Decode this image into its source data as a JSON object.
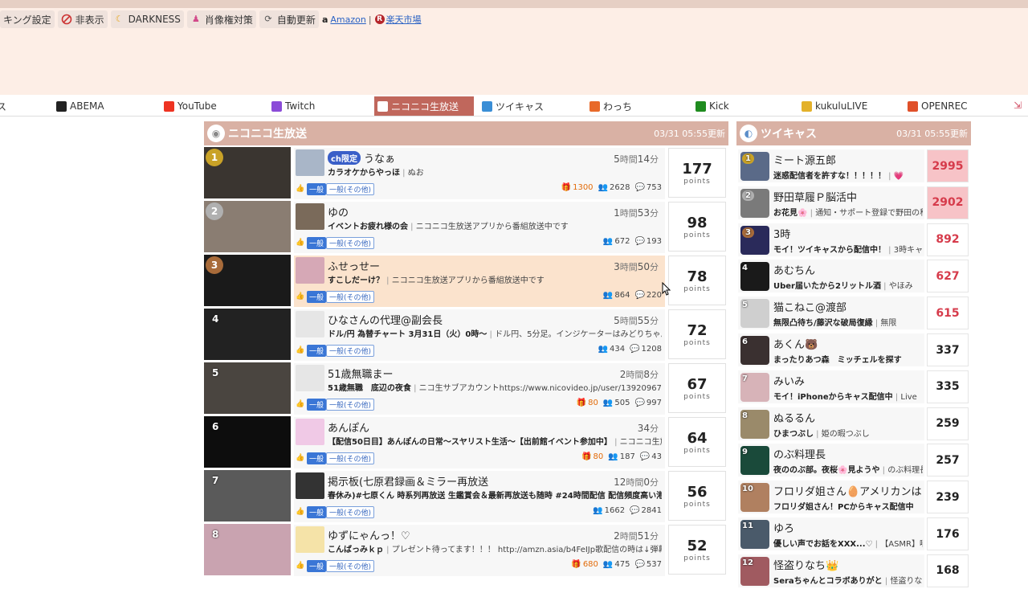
{
  "toolbar": {
    "items": [
      {
        "label": "キング設定",
        "icon": "list-icon"
      },
      {
        "label": "非表示",
        "icon": "prohibit-icon"
      },
      {
        "label": "DARKNESS",
        "icon": "moon-icon"
      },
      {
        "label": "肖像権対策",
        "icon": "person-icon"
      },
      {
        "label": "自動更新",
        "icon": "refresh-icon"
      }
    ],
    "amazon": "Amazon",
    "rakuten": "楽天市場",
    "sep": "|"
  },
  "tabs": [
    {
      "label": "ス",
      "icon": "",
      "color": "#888"
    },
    {
      "label": "ABEMA",
      "icon": "abema-icon",
      "color": "#222"
    },
    {
      "label": "YouTube",
      "icon": "youtube-icon",
      "color": "#e32"
    },
    {
      "label": "Twitch",
      "icon": "twitch-icon",
      "color": "#8b4bd8"
    },
    {
      "label": "ニコニコ生放送",
      "icon": "niconico-icon",
      "color": "#fff",
      "active": true
    },
    {
      "label": "ツイキャス",
      "icon": "twitcasting-icon",
      "color": "#3a8ed6"
    },
    {
      "label": "わっち",
      "icon": "wacchi-icon",
      "color": "#e86a2a"
    },
    {
      "label": "Kick",
      "icon": "kick-icon",
      "color": "#1f8c1f"
    },
    {
      "label": "kukuluLIVE",
      "icon": "kukulu-icon",
      "color": "#e3b12a"
    },
    {
      "label": "OPENREC",
      "icon": "openrec-icon",
      "color": "#e0502a"
    }
  ],
  "nico": {
    "title": "ニコニコ生放送",
    "updated": "03/31 05:55更新",
    "rows": [
      {
        "rank": "1",
        "ch": "ch限定",
        "name": "うなぁ",
        "hours": "5",
        "mins": "14",
        "desc": "カラオケからやっほ",
        "sub": "ぬお",
        "gift": "1300",
        "viewers": "2628",
        "comments": "753",
        "points": "177",
        "hl": false
      },
      {
        "rank": "2",
        "ch": "",
        "name": "ゆの",
        "hours": "1",
        "mins": "53",
        "desc": "イベントお疲れ様の会",
        "sub": "ニコニコ生放送アプリから番組放送中です",
        "gift": "",
        "viewers": "672",
        "comments": "193",
        "points": "98",
        "hl": false
      },
      {
        "rank": "3",
        "ch": "",
        "name": "ふせっせー",
        "hours": "3",
        "mins": "50",
        "desc": "すこしだーけ？",
        "sub": "ニコニコ生放送アプリから番組放送中です",
        "gift": "",
        "viewers": "864",
        "comments": "220",
        "points": "78",
        "hl": true
      },
      {
        "rank": "4",
        "ch": "",
        "name": "ひなさんの代理@副会長",
        "hours": "5",
        "mins": "55",
        "desc": "ドル/円 為替チャート 3月31日（火）0時〜",
        "sub": "ドル円、5分足。インジケーターはみどりちゃん",
        "gift": "",
        "viewers": "434",
        "comments": "1208",
        "points": "72",
        "hl": false
      },
      {
        "rank": "5",
        "ch": "",
        "name": "51歳無職まー",
        "hours": "2",
        "mins": "8",
        "desc": "51歳無職　底辺の夜食",
        "sub": "ニコ生サブアカウントhttps://www.nicovideo.jp/user/139209674ふ",
        "gift": "80",
        "viewers": "505",
        "comments": "997",
        "points": "67",
        "hl": false
      },
      {
        "rank": "6",
        "ch": "",
        "name": "あんぽん",
        "hours": "",
        "mins": "34",
        "desc": "【配信50日目】あんぽんの日常〜スヤリスト生活〜【出前館イベント参加中】",
        "sub": "ニコニコ生放",
        "gift": "80",
        "viewers": "187",
        "comments": "43",
        "points": "64",
        "hl": false
      },
      {
        "rank": "7",
        "ch": "",
        "name": "掲示板(七原君録画＆ミラー再放送",
        "hours": "12",
        "mins": "0",
        "desc": "春休み)#七原くん 時系列再放送 生鑑賞会＆最新再放送も随時 #24時間配信 配信頻度高い港平",
        "sub": "",
        "gift": "",
        "viewers": "1662",
        "comments": "2841",
        "points": "56",
        "hl": false
      },
      {
        "rank": "8",
        "ch": "",
        "name": "ゆずにゃんっ！♡",
        "hours": "2",
        "mins": "51",
        "desc": "こんばっみｋｐ",
        "sub": "プレゼント待ってます！！！ http://amzn.asia/b4FeIJp歌配信の時は↓弾幕",
        "gift": "680",
        "viewers": "475",
        "comments": "537",
        "points": "52",
        "hl": false
      }
    ],
    "genre_main": "一般",
    "genre_sub": "一般(その他)",
    "hour_unit": "時間",
    "min_unit": "分",
    "points_label": "points"
  },
  "twi": {
    "title": "ツイキャス",
    "updated": "03/31 05:55更新",
    "rows": [
      {
        "rank": "1",
        "name": "ミート源五郎",
        "desc": "迷惑配信者を許すな！！！！！",
        "sub": "💗",
        "points": "2995",
        "style": "pink"
      },
      {
        "rank": "2",
        "name": "野田草履Ｐ脳活中",
        "desc": "お花見🌸",
        "sub": "通知・サポート登録で野田の私",
        "points": "2902",
        "style": "pink"
      },
      {
        "rank": "3",
        "name": "3時",
        "desc": "モイ！ツイキャスから配信中！",
        "sub": "3時キャス",
        "points": "892",
        "style": "red"
      },
      {
        "rank": "4",
        "name": "あむちん",
        "desc": "Uber届いたから2リットル酒",
        "sub": "やほみ",
        "points": "627",
        "style": "red"
      },
      {
        "rank": "5",
        "name": "猫こねこ@渡部",
        "desc": "無限凸待ち/藤沢な破局復縁",
        "sub": "無限",
        "points": "615",
        "style": "red"
      },
      {
        "rank": "6",
        "name": "あくん🐻",
        "desc": "まったりあつ森　ミッチェルを探す",
        "sub": "",
        "points": "337",
        "style": ""
      },
      {
        "rank": "7",
        "name": "みいみ",
        "desc": "モイ！iPhoneからキャス配信中",
        "sub": "Live",
        "points": "335",
        "style": ""
      },
      {
        "rank": "8",
        "name": "ぬるるん",
        "desc": "ひまつぶし",
        "sub": "姫の暇つぶし",
        "points": "259",
        "style": ""
      },
      {
        "rank": "9",
        "name": "のぶ料理長",
        "desc": "夜ののぶ部。夜桜🌸見ようや",
        "sub": "のぶ料理長",
        "points": "257",
        "style": ""
      },
      {
        "rank": "10",
        "name": "フロリダ姐さん🥚アメリカンは",
        "desc": "フロリダ姐さん！PCからキャス配信中",
        "sub": "",
        "points": "239",
        "style": ""
      },
      {
        "rank": "11",
        "name": "ゆろ",
        "desc": "優しい声でお話をXXX...♡",
        "sub": "【ASMR】喘",
        "points": "176",
        "style": ""
      },
      {
        "rank": "12",
        "name": "怪盗りなち👑",
        "desc": "Seraちゃんとコラボありがと",
        "sub": "怪盗りな",
        "points": "168",
        "style": ""
      }
    ]
  }
}
